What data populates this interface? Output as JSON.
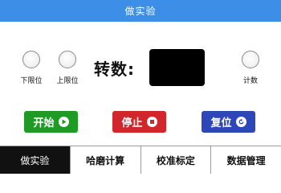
{
  "window": {
    "title": "做实验"
  },
  "indicators": [
    {
      "label": "下限位",
      "state": "off"
    },
    {
      "label": "上限位",
      "state": "off"
    },
    {
      "label": "计数",
      "state": "off"
    }
  ],
  "speed": {
    "label": "转数:",
    "value": ""
  },
  "buttons": {
    "start": {
      "label": "开始",
      "icon": "play-icon",
      "color": "#1f9a24"
    },
    "stop": {
      "label": "停止",
      "icon": "stop-icon",
      "color": "#d1262b"
    },
    "reset": {
      "label": "复位",
      "icon": "reset-icon",
      "color": "#2e47b8"
    }
  },
  "tabs": [
    {
      "label": "做实验",
      "active": true
    },
    {
      "label": "哈磨计算",
      "active": false
    },
    {
      "label": "校准标定",
      "active": false
    },
    {
      "label": "数据管理",
      "active": false
    }
  ],
  "colors": {
    "title_bar": "#3d8ee6",
    "active_tab": "#111111"
  }
}
